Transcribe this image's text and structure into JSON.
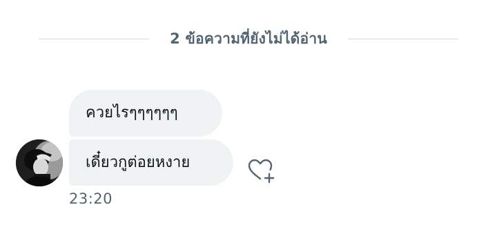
{
  "divider": {
    "label": "2 ข้อความที่ยังไม่ได้อ่าน"
  },
  "messages": [
    {
      "text": "ควยไรๆๆๆๆๆๆ"
    },
    {
      "text": "เดี๋ยวกูต่อยหงาย"
    }
  ],
  "timestamp": "23:20",
  "icons": {
    "avatar": "user-avatar",
    "react": "heart-plus-icon"
  },
  "colors": {
    "bubble_bg": "#eff3f4",
    "secondary_text": "#536471",
    "primary_text": "#0f1419",
    "divider_line": "#cfd9de"
  }
}
